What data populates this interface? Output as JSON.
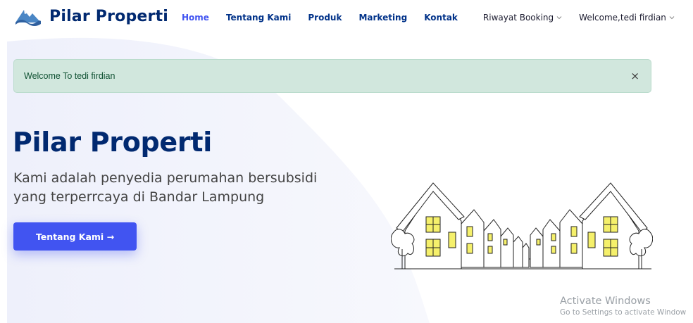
{
  "brand": {
    "name": "Pilar Properti",
    "logo_icon": "wave-mountain-icon"
  },
  "nav": {
    "items": [
      {
        "label": "Home",
        "active": true
      },
      {
        "label": "Tentang Kami",
        "active": false
      },
      {
        "label": "Produk",
        "active": false
      },
      {
        "label": "Marketing",
        "active": false
      },
      {
        "label": "Kontak",
        "active": false
      }
    ],
    "booking_dropdown": "Riwayat Booking",
    "user_dropdown": "Welcome,tedi firdian"
  },
  "alert": {
    "text": "Welcome To tedi firdian",
    "close": "×",
    "type": "success"
  },
  "hero": {
    "title": "Pilar Properti",
    "subtitle": "Kami adalah penyedia perumahan bersubsidi yang terperrcaya di Bandar Lampung",
    "button_label": "Tentang Kami →",
    "illustration": "houses-perspective-illustration"
  },
  "watermark": {
    "title": "Activate Windows",
    "subtitle": "Go to Settings to activate Window"
  },
  "colors": {
    "primary": "#4154f1",
    "navy": "#012970",
    "alert_bg": "#d1e7dd",
    "alert_text": "#0f5132",
    "window_yellow": "#f5f06b"
  }
}
